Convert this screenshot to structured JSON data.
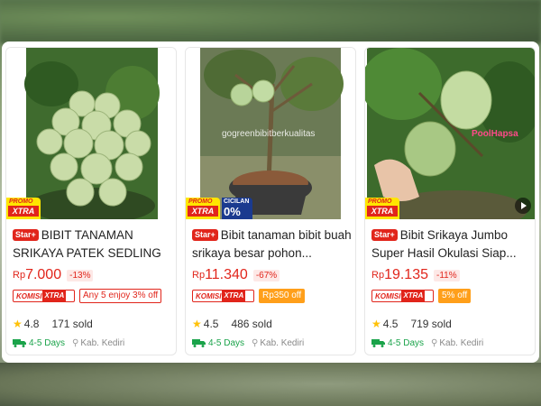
{
  "products": [
    {
      "promo": {
        "top": "PROMO",
        "bottom": "XTRA"
      },
      "star_badge": "Star+",
      "title": "BIBIT TANAMAN SRIKAYA PATEK SEDLING",
      "currency": "Rp",
      "price": "7.000",
      "discount": "-13%",
      "komisi": {
        "a": "KOMISI",
        "b": "XTRA"
      },
      "offer": "Any 5 enjoy 3% off",
      "rating": "4.8",
      "sold": "171 sold",
      "shipping": "4-5 Days",
      "location": "Kab. Kediri"
    },
    {
      "promo": {
        "top": "PROMO",
        "bottom": "XTRA"
      },
      "cicilan": {
        "top": "CICILAN",
        "bottom": "0%"
      },
      "watermark": "gogreenbibitberkualitas",
      "star_badge": "Star+",
      "title": "Bibit tanaman bibit buah srikaya besar pohon...",
      "currency": "Rp",
      "price": "11.340",
      "discount": "-67%",
      "komisi": {
        "a": "KOMISI",
        "b": "XTRA"
      },
      "offer": "Rp350 off",
      "rating": "4.5",
      "sold": "486 sold",
      "shipping": "4-5 Days",
      "location": "Kab. Kediri"
    },
    {
      "promo": {
        "top": "PROMO",
        "bottom": "XTRA"
      },
      "watermark": "PoolHapsa",
      "star_badge": "Star+",
      "title": "Bibit Srikaya Jumbo Super Hasil Okulasi Siap...",
      "currency": "Rp",
      "price": "19.135",
      "discount": "-11%",
      "komisi": {
        "a": "KOMISI",
        "b": "XTRA"
      },
      "offer": "5% off",
      "rating": "4.5",
      "sold": "719 sold",
      "shipping": "4-5 Days",
      "location": "Kab. Kediri"
    }
  ],
  "colors": {
    "accent": "#e1251b",
    "shipping": "#1aa34a",
    "star": "#ffc107",
    "offer_orange": "#ff9f1a"
  },
  "icons": [
    "star-icon",
    "truck-icon",
    "location-pin-icon",
    "play-icon"
  ]
}
